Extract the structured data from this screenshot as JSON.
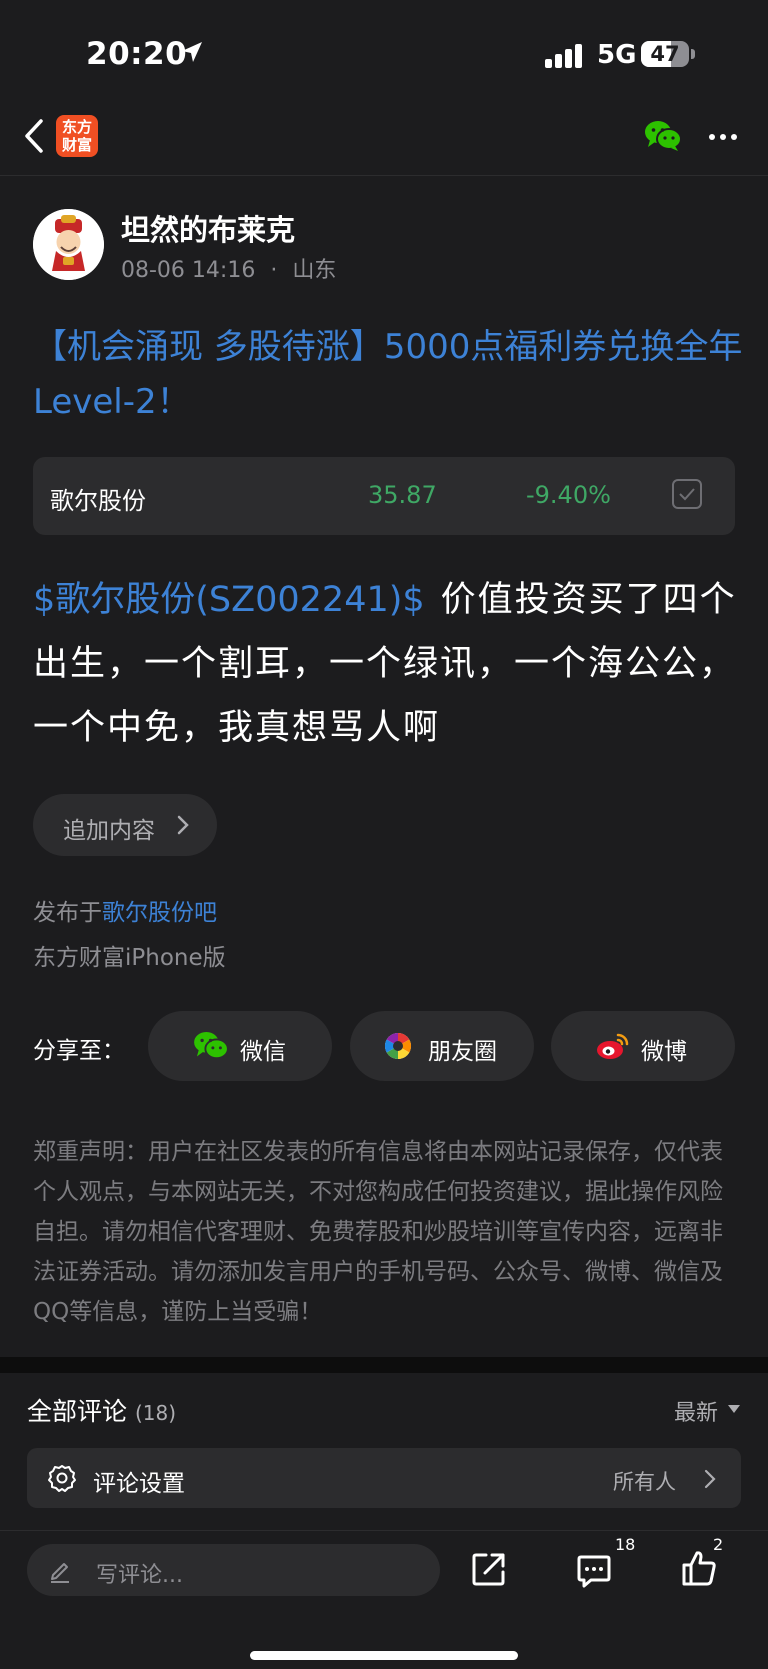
{
  "status_bar": {
    "time": "20:20",
    "network": "5G",
    "battery": "47"
  },
  "nav": {
    "logo_text": "东方财富"
  },
  "author": {
    "name": "坦然的布莱克",
    "date": "08-06 14:16",
    "location": "山东",
    "separator": "·"
  },
  "post": {
    "title": "【机会涌现 多股待涨】5000点福利券兑换全年Level-2！",
    "stock_card": {
      "name": "歌尔股份",
      "price": "35.87",
      "change": "-9.40%"
    },
    "stock_link": "$歌尔股份(SZ002241)$",
    "body": "价值投资买了四个出生，一个割耳，一个绿讯，一个海公公，一个中免，我真想骂人啊",
    "append_label": "追加内容",
    "published_prefix": "发布于",
    "bar_name": "歌尔股份吧",
    "client": "东方财富iPhone版"
  },
  "share": {
    "label": "分享至：",
    "wechat": "微信",
    "moments": "朋友圈",
    "weibo": "微博"
  },
  "disclaimer": "郑重声明：用户在社区发表的所有信息将由本网站记录保存，仅代表个人观点，与本网站无关，不对您构成任何投资建议，据此操作风险自担。请勿相信代客理财、免费荐股和炒股培训等宣传内容，远离非法证券活动。请勿添加发言用户的手机号码、公众号、微博、微信及QQ等信息，谨防上当受骗！",
  "comments": {
    "title": "全部评论",
    "count": "(18)",
    "sort": "最新",
    "settings_label": "评论设置",
    "settings_value": "所有人"
  },
  "bottom_bar": {
    "placeholder": "写评论...",
    "comment_count": "18",
    "like_count": "2"
  },
  "colors": {
    "background": "#1c1c1e",
    "link": "#3d82d6",
    "fall": "#3fa865",
    "card": "#2c2c2e",
    "logo": "#f04f23",
    "wechat": "#2dc100"
  }
}
